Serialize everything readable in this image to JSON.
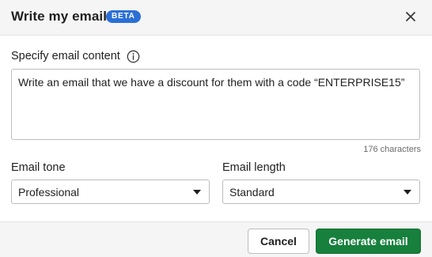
{
  "dialog": {
    "title": "Write my email",
    "badge": "BETA",
    "close_icon": "close-icon"
  },
  "content": {
    "label": "Specify email content",
    "info_icon": "info-icon",
    "textarea_value": "Write an email that we have a discount for them with a code “ENTERPRISE15”",
    "char_count": "176 characters"
  },
  "tone": {
    "label": "Email tone",
    "selected": "Professional"
  },
  "length": {
    "label": "Email length",
    "selected": "Standard"
  },
  "footer": {
    "cancel_label": "Cancel",
    "generate_label": "Generate email"
  },
  "colors": {
    "badge": "#2b6fd6",
    "primary_button": "#17803d",
    "header_bg": "#f5f5f5"
  }
}
